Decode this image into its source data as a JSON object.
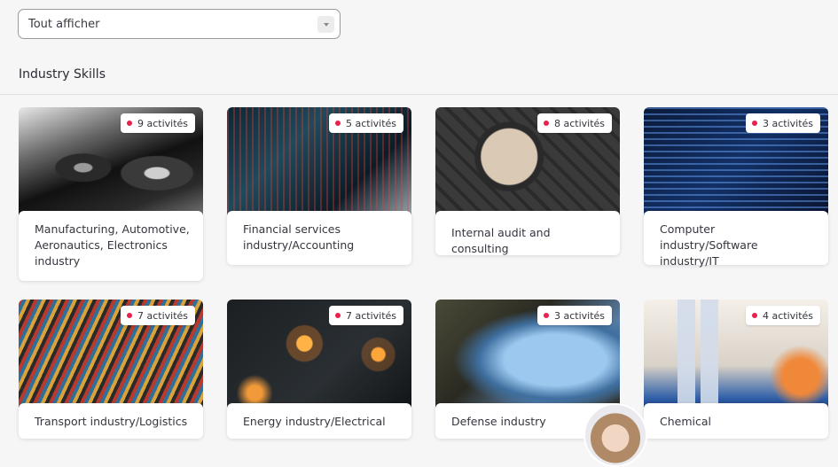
{
  "filter": {
    "value": "Tout afficher"
  },
  "section": {
    "title": "Industry Skills"
  },
  "cards": [
    {
      "label": "Manufacturing, Automotive, Aeronautics, Electronics industry",
      "activities": "9 activités"
    },
    {
      "label": "Financial services industry/Accounting",
      "activities": "5 activités"
    },
    {
      "label": "Internal audit and consulting",
      "activities": "8 activités"
    },
    {
      "label": "Computer industry/Software industry/IT",
      "activities": "3 activités"
    },
    {
      "label": "Transport industry/Logistics",
      "activities": "7 activités"
    },
    {
      "label": "Energy industry/Electrical",
      "activities": "7 activités"
    },
    {
      "label": "Defense industry",
      "activities": "3 activités"
    },
    {
      "label": "Chemical",
      "activities": "4 activités"
    }
  ],
  "colors": {
    "badge_dot": "#e8224f",
    "background": "#f6f6f7"
  }
}
